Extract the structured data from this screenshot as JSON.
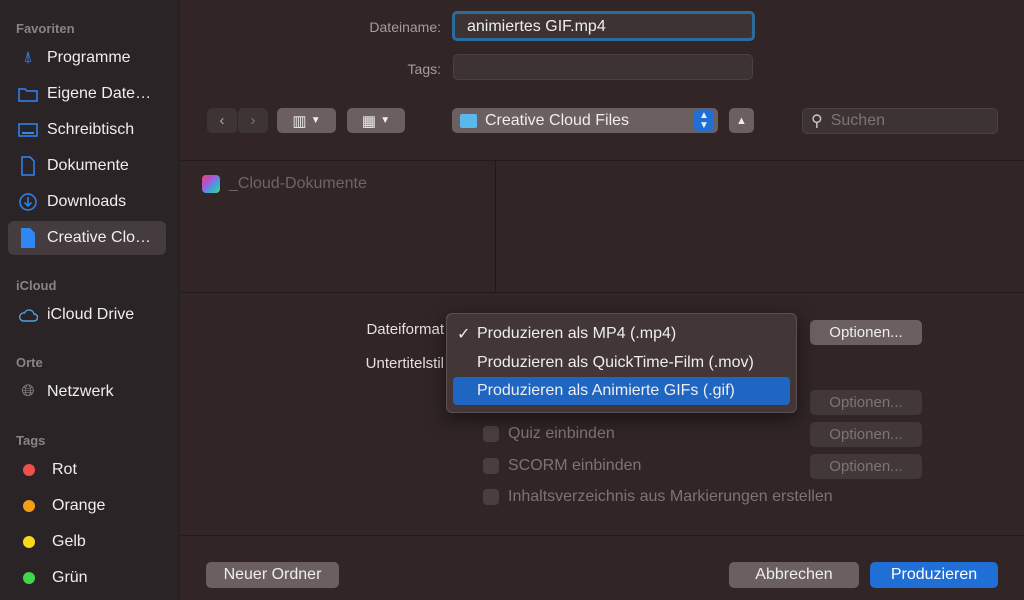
{
  "sidebar": {
    "favorites_header": "Favoriten",
    "favorites": [
      {
        "label": "Programme",
        "icon": "apps-icon"
      },
      {
        "label": "Eigene Date…",
        "icon": "folder-icon"
      },
      {
        "label": "Schreibtisch",
        "icon": "desktop-icon"
      },
      {
        "label": "Dokumente",
        "icon": "document-icon"
      },
      {
        "label": "Downloads",
        "icon": "download-icon"
      },
      {
        "label": "Creative Clo…",
        "icon": "file-icon",
        "selected": true
      }
    ],
    "icloud_header": "iCloud",
    "icloud": [
      {
        "label": "iCloud Drive",
        "icon": "cloud-icon"
      }
    ],
    "places_header": "Orte",
    "places": [
      {
        "label": "Netzwerk",
        "icon": "globe-icon"
      }
    ],
    "tags_header": "Tags",
    "tags": [
      {
        "label": "Rot",
        "color": "#f0504c"
      },
      {
        "label": "Orange",
        "color": "#f59d17"
      },
      {
        "label": "Gelb",
        "color": "#f8d91c"
      },
      {
        "label": "Grün",
        "color": "#3fd84b"
      }
    ]
  },
  "form": {
    "filename_label": "Dateiname:",
    "filename_value": "animiertes GIF.mp4",
    "tags_label": "Tags:",
    "tags_value": ""
  },
  "toolbar": {
    "location": "Creative Cloud Files",
    "search_placeholder": "Suchen"
  },
  "browser": {
    "items": [
      {
        "name": "_Cloud-Dokumente"
      }
    ]
  },
  "options": {
    "format_label": "Dateiformat",
    "subtitle_label": "Untertitelstil",
    "format_options": [
      {
        "label": "Produzieren als MP4 (.mp4)",
        "checked": true
      },
      {
        "label": "Produzieren als QuickTime-Film (.mov)"
      },
      {
        "label": "Produzieren als Animierte GIFs (.gif)",
        "highlighted": true
      }
    ],
    "options_button": "Optionen...",
    "checkboxes": [
      {
        "label": "Quiz einbinden",
        "checked": false
      },
      {
        "label": "SCORM einbinden",
        "checked": false
      },
      {
        "label": "Inhaltsverzeichnis aus Markierungen erstellen",
        "checked": false
      }
    ]
  },
  "footer": {
    "new_folder": "Neuer Ordner",
    "cancel": "Abbrechen",
    "produce": "Produzieren"
  },
  "colors": {
    "accent": "#1f6fd6"
  }
}
